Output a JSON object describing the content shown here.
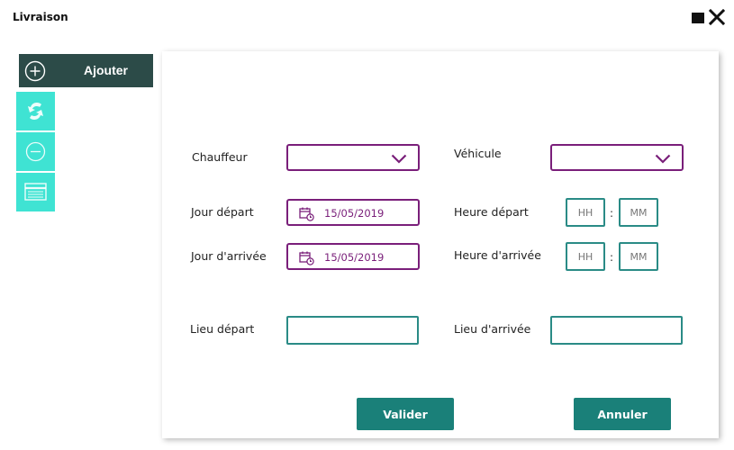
{
  "window": {
    "title": "Livraison"
  },
  "toolbar": {
    "add_label": "Ajouter"
  },
  "form": {
    "driver_label": "Chauffeur",
    "vehicle_label": "Véhicule",
    "departure_day_label": "Jour départ",
    "departure_day_value": "15/05/2019",
    "arrival_day_label": "Jour d'arrivée",
    "arrival_day_value": "15/05/2019",
    "departure_time_label": "Heure départ",
    "arrival_time_label": "Heure d'arrivée",
    "hour_placeholder": "HH",
    "minute_placeholder": "MM",
    "time_separator": ":",
    "departure_place_label": "Lieu départ",
    "arrival_place_label": "Lieu d'arrivée"
  },
  "actions": {
    "validate_label": "Valider",
    "cancel_label": "Annuler"
  },
  "colors": {
    "accent_purple": "#7a1f7a",
    "teal": "#1a8079",
    "sidebar_cyan": "#3fe3d3",
    "dark_header": "#2c4b48"
  }
}
